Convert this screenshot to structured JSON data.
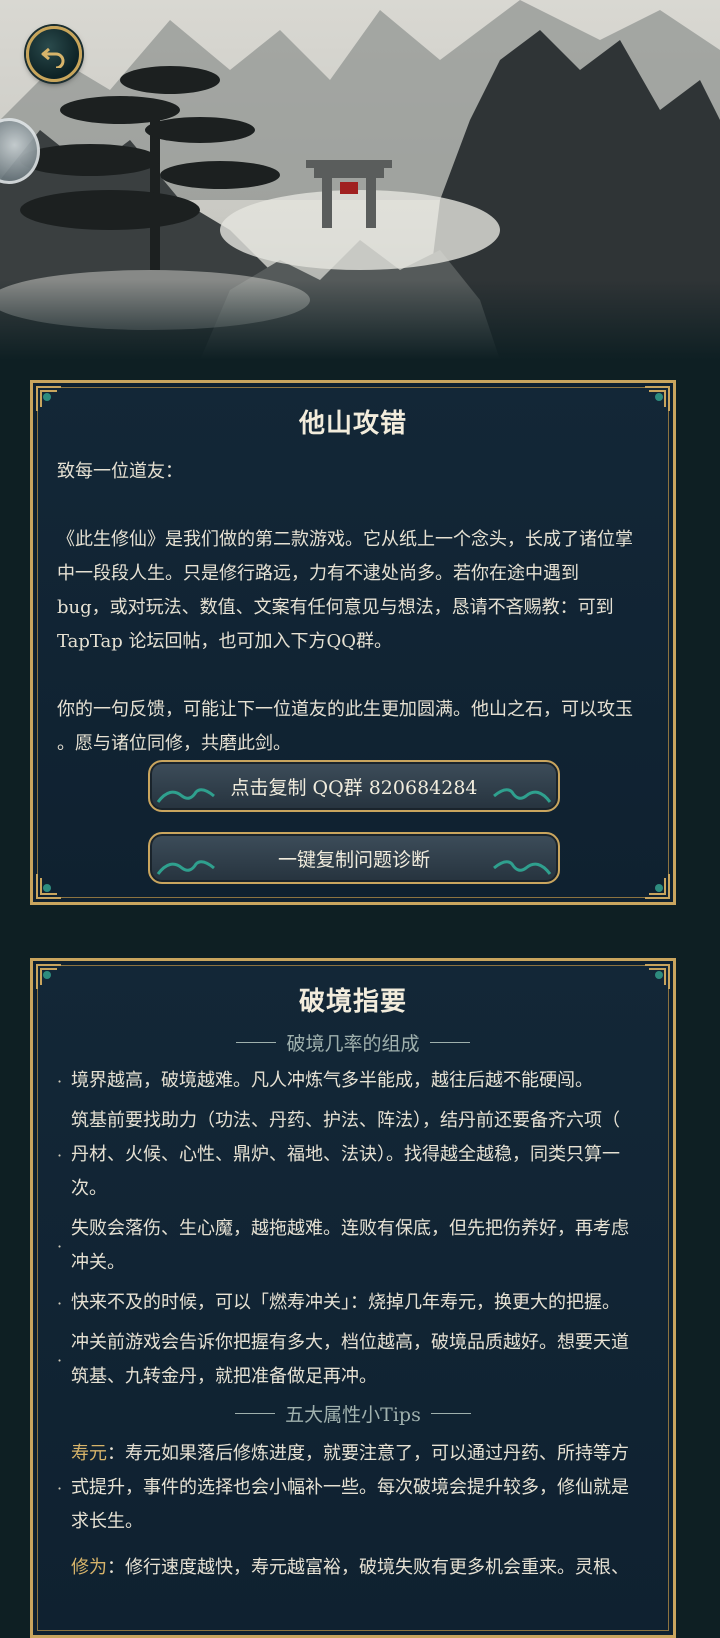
{
  "header": {
    "back_icon": "back-arrow-icon",
    "side_tab_icon": "avatar-tab"
  },
  "feedback": {
    "title": "他山攻错",
    "greeting": "致每一位道友：",
    "para1_lines": [
      "《此生修仙》是我们做的第二款游戏。它从纸上一个念头，长成了诸位掌",
      "中一段段人生。只是修行路远，力有不逮处尚多。若你在途中遇到",
      "bug，或对玩法、数值、文案有任何意见与想法，恳请不吝赐教：可到",
      "TapTap 论坛回帖，也可加入下方QQ群。"
    ],
    "para2_lines": [
      "你的一句反馈，可能让下一位道友的此生更加圆满。他山之石，可以攻玉",
      "。愿与诸位同修，共磨此剑。"
    ],
    "copy_qq_label": "点击复制 QQ群 820684284",
    "copy_diag_label": "一键复制问题诊断"
  },
  "guide": {
    "title": "破境指要",
    "section1": "破境几率的组成",
    "bullets": [
      [
        "境界越高，破境越难。凡人冲炼气多半能成，越往后越不能硬闯。"
      ],
      [
        "筑基前要找助力（功法、丹药、护法、阵法），结丹前还要备齐六项（",
        "丹材、火候、心性、鼎炉、福地、法诀）。找得越全越稳，同类只算一",
        "次。"
      ],
      [
        "失败会落伤、生心魔，越拖越难。连败有保底，但先把伤养好，再考虑",
        "冲关。"
      ],
      [
        "快来不及的时候，可以「燃寿冲关」：烧掉几年寿元，换更大的把握。"
      ],
      [
        "冲关前游戏会告诉你把握有多大，档位越高，破境品质越好。想要天道",
        "筑基、九转金丹，就把准备做足再冲。"
      ]
    ],
    "section2": "五大属性小Tips",
    "tip1_key": "寿元",
    "tip1_lines": [
      "：寿元如果落后修炼进度，就要注意了，可以通过丹药、所持等方",
      "式提升，事件的选择也会小幅补一些。每次破境会提升较多，修仙就是",
      "求长生。"
    ],
    "tip2_key": "修为",
    "tip2_line": "：修行速度越快，寿元越富裕，破境失败有更多机会重来。灵根、"
  }
}
